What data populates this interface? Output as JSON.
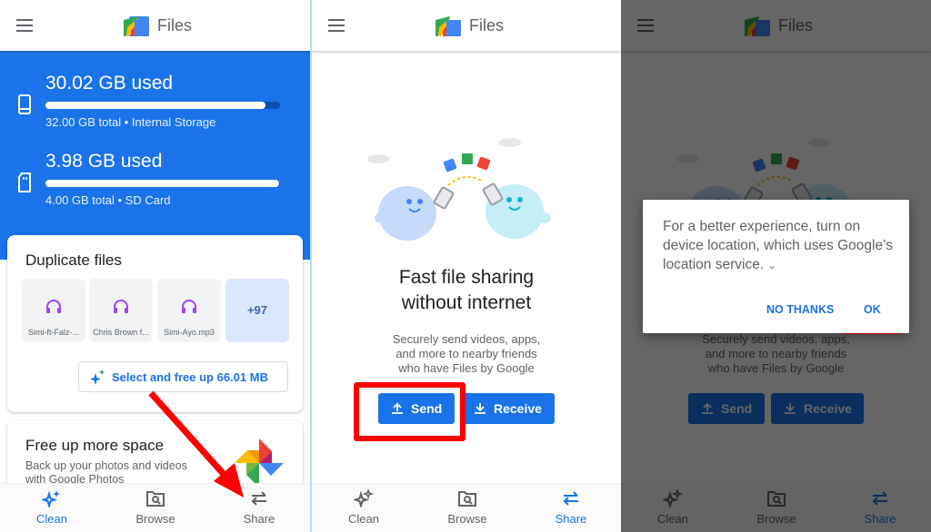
{
  "app": {
    "title": "Files"
  },
  "nav": {
    "items": [
      {
        "label": "Clean",
        "icon": "sparkle-icon"
      },
      {
        "label": "Browse",
        "icon": "folder-search-icon"
      },
      {
        "label": "Share",
        "icon": "swap-arrows-icon"
      }
    ]
  },
  "panel1": {
    "active_tab": "Clean",
    "storage": [
      {
        "used": "30.02 GB used",
        "detail": "32.00 GB total • Internal Storage",
        "fraction": 0.938,
        "icon": "phone-icon"
      },
      {
        "used": "3.98 GB used",
        "detail": "4.00 GB total • SD Card",
        "fraction": 0.995,
        "icon": "sd-card-icon"
      }
    ],
    "duplicate_card": {
      "title": "Duplicate files",
      "files": [
        {
          "name": "Simi-ft-Falz-...",
          "icon": "headphones-icon"
        },
        {
          "name": "Chris Brown f...",
          "icon": "headphones-icon"
        },
        {
          "name": "Simi-Ayo.mp3",
          "icon": "headphones-icon"
        }
      ],
      "more_count": "+97",
      "action": "Select and free up 66.01 MB"
    },
    "photos_card": {
      "title": "Free up more space",
      "subtitle": "Back up your photos and videos with Google Photos"
    }
  },
  "panel2": {
    "active_tab": "Share",
    "title_line1": "Fast file sharing",
    "title_line2": "without internet",
    "subtitle_lines": [
      "Securely send videos, apps,",
      "and more to nearby friends",
      "who have Files by Google"
    ],
    "send_label": "Send",
    "receive_label": "Receive"
  },
  "panel3": {
    "active_tab": "Share",
    "dialog": {
      "message": "For a better experience, turn on device location, which uses Google’s location service.",
      "no_thanks": "NO THANKS",
      "ok": "OK"
    }
  },
  "annotation_colors": {
    "highlight": "#ff0000",
    "brand_blue": "#1a73e8"
  }
}
